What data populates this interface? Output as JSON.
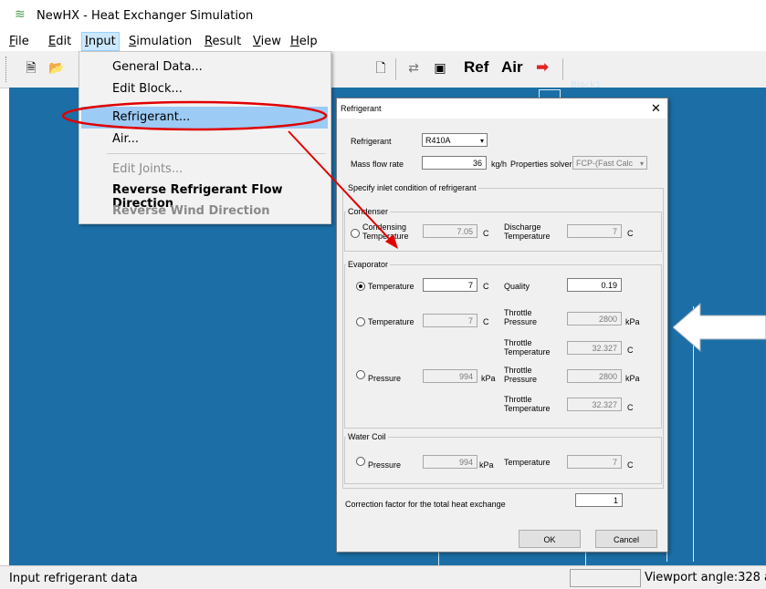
{
  "app": {
    "title": "NewHX - Heat Exchanger Simulation"
  },
  "menubar": {
    "items": [
      {
        "mn": "F",
        "rest": "ile"
      },
      {
        "mn": "E",
        "rest": "dit"
      },
      {
        "mn": "I",
        "rest": "nput"
      },
      {
        "mn": "S",
        "rest": "imulation"
      },
      {
        "mn": "R",
        "rest": "esult"
      },
      {
        "mn": "V",
        "rest": "iew"
      },
      {
        "mn": "H",
        "rest": "elp"
      }
    ]
  },
  "toolbar": {
    "ref_label": "Ref",
    "air_label": "Air"
  },
  "workspace": {
    "block_label": "Block1"
  },
  "input_menu": {
    "general": "General Data...",
    "edit_block": "Edit Block...",
    "refrigerant": "Refrigerant...",
    "air": "Air...",
    "edit_joints": "Edit Joints...",
    "reverse_ref": "Reverse Refrigerant Flow Direction",
    "reverse_wind": "Reverse Wind Direction"
  },
  "dialog": {
    "title": "Refrigerant",
    "refrigerant_label": "Refrigerant",
    "refrigerant_value": "R410A",
    "mass_flow_label": "Mass flow rate",
    "mass_flow_value": "36",
    "mass_flow_unit": "kg/h",
    "solver_label": "Properties solver",
    "solver_value": "FCP-(Fast Calc",
    "inlet_group": "Specify inlet condition of refrigerant",
    "condenser": {
      "title": "Condenser",
      "cond_temp_label_1": "Condensing",
      "cond_temp_label_2": "Temperature",
      "cond_temp_value": "7.05",
      "cond_temp_unit": "C",
      "disch_label_1": "Discharge",
      "disch_label_2": "Temperature",
      "disch_value": "7",
      "disch_unit": "C"
    },
    "evaporator": {
      "title": "Evaporator",
      "r1_temp_label": "Temperature",
      "r1_temp_value": "7",
      "r1_temp_unit": "C",
      "r1_quality_label": "Quality",
      "r1_quality_value": "0.19",
      "r2_temp_label": "Temperature",
      "r2_temp_value": "7",
      "r2_temp_unit": "C",
      "r2_tp_label_1": "Throttle",
      "r2_tp_label_2": "Pressure",
      "r2_tp_value": "2800",
      "r2_tp_unit": "kPa",
      "r2_tt_label_1": "Throttle",
      "r2_tt_label_2": "Temperature",
      "r2_tt_value": "32.327",
      "r2_tt_unit": "C",
      "r3_pres_label": "Pressure",
      "r3_pres_value": "994",
      "r3_pres_unit": "kPa",
      "r3_tp_label_1": "Throttle",
      "r3_tp_label_2": "Pressure",
      "r3_tp_value": "2800",
      "r3_tp_unit": "kPa",
      "r3_tt_label_1": "Throttle",
      "r3_tt_label_2": "Temperature",
      "r3_tt_value": "32.327",
      "r3_tt_unit": "C"
    },
    "water_coil": {
      "title": "Water Coil",
      "pres_label": "Pressure",
      "pres_value": "994",
      "pres_unit": "kPa",
      "temp_label": "Temperature",
      "temp_value": "7",
      "temp_unit": "C"
    },
    "correction_label": "Correction factor for the total heat exchange",
    "correction_value": "1",
    "ok": "OK",
    "cancel": "Cancel"
  },
  "status": {
    "left": "Input refrigerant data",
    "right": "Viewport angle:328 a"
  },
  "colors": {
    "workspace": "#1b6fa6",
    "annotation": "#e00000",
    "menu_highlight": "#9ccbf5"
  }
}
